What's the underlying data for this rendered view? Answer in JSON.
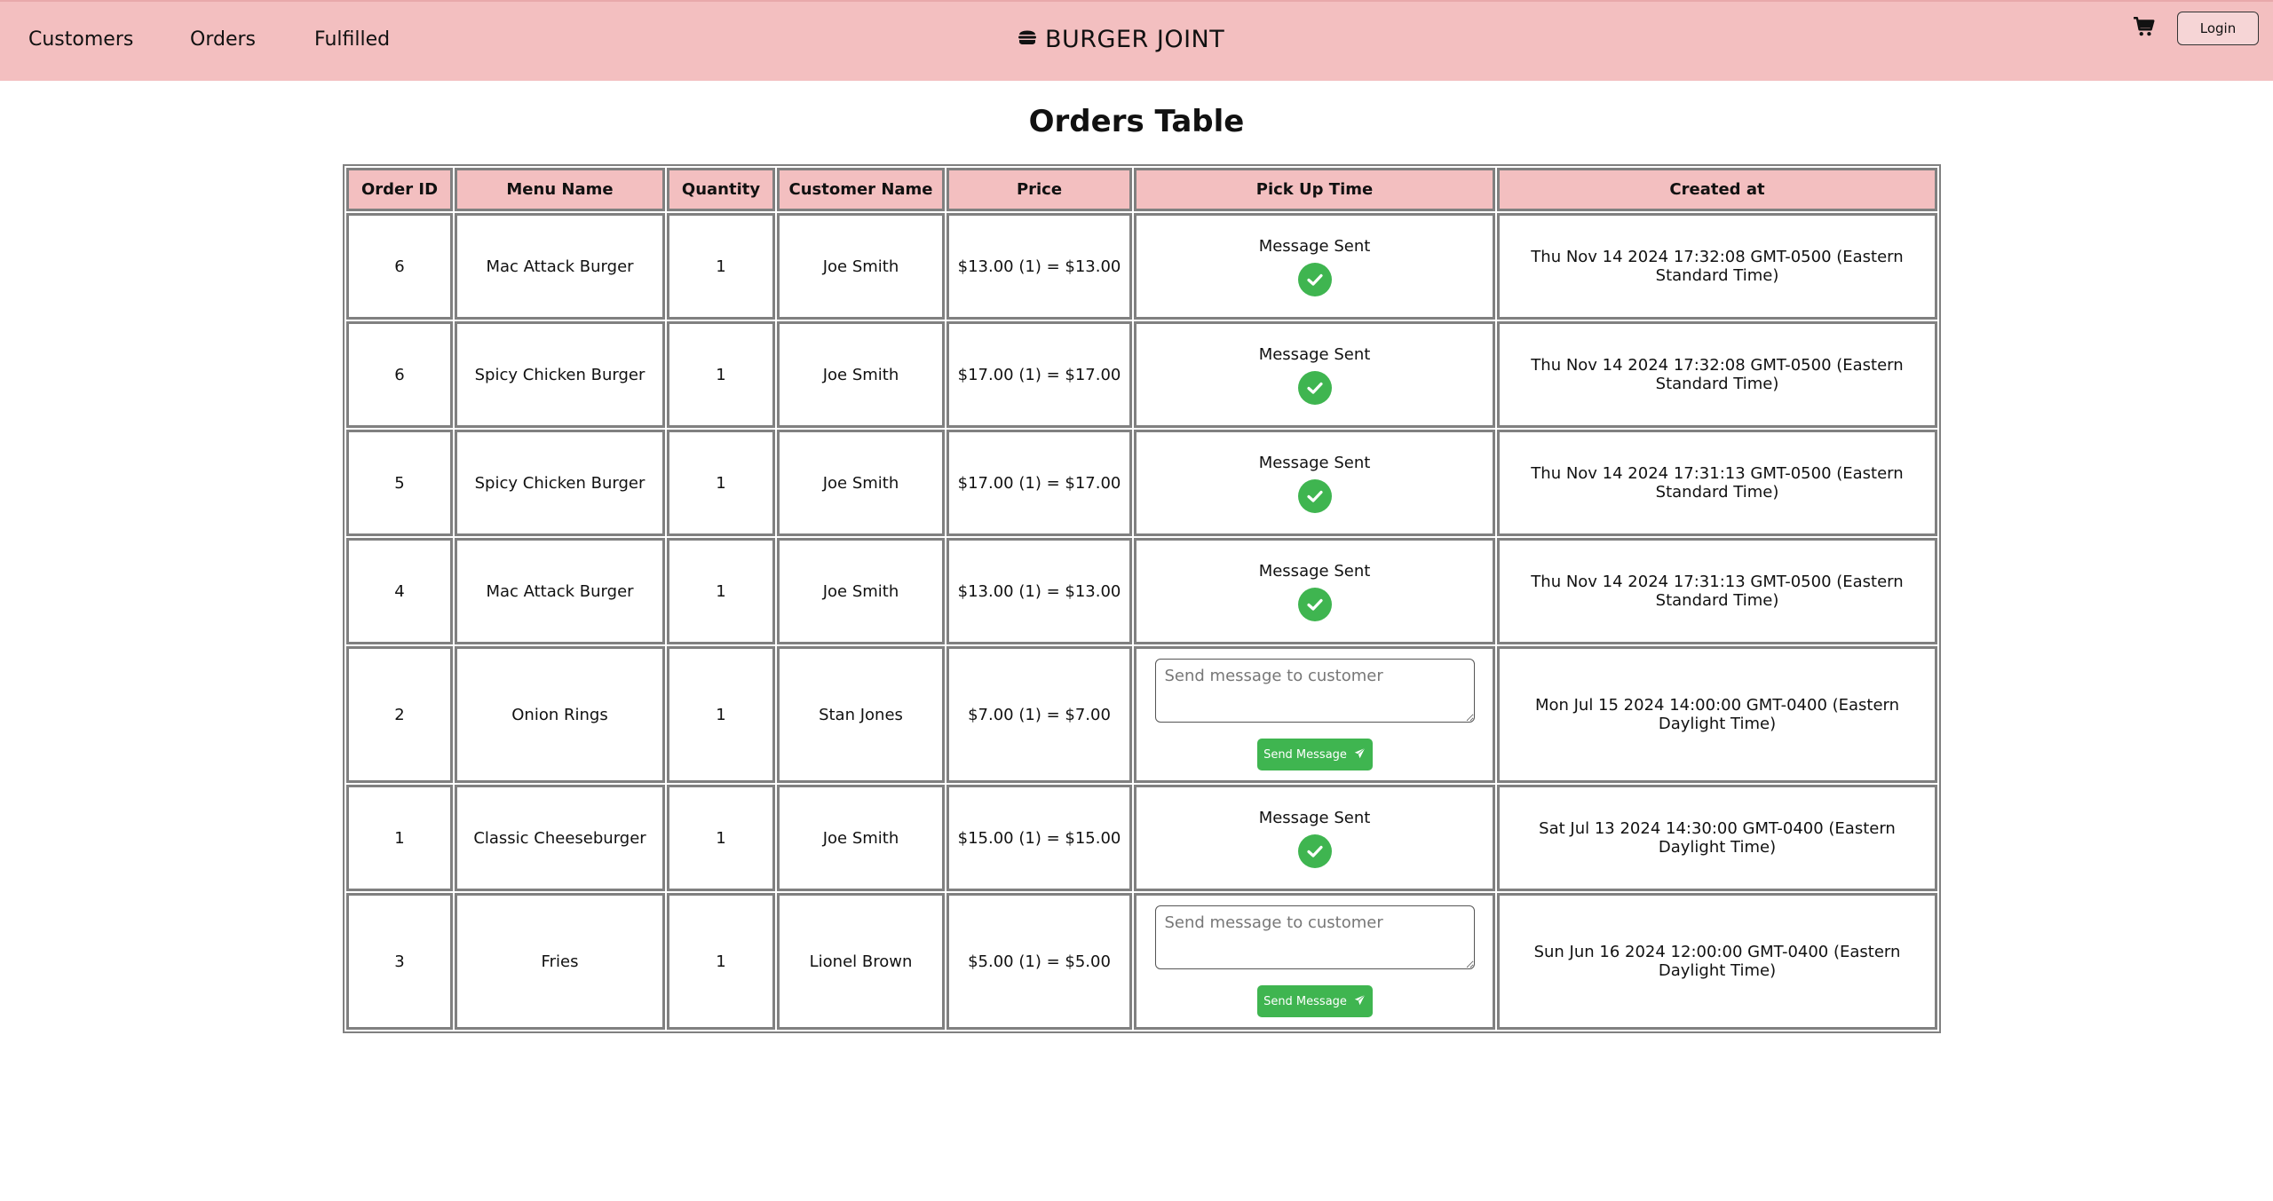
{
  "nav": {
    "links": [
      "Customers",
      "Orders",
      "Fulfilled"
    ],
    "brand": "BURGER JOINT",
    "brand_icon": "burger-icon",
    "cart_icon": "cart-icon",
    "login_label": "Login"
  },
  "colors": {
    "nav_bg": "#f3bfc0",
    "success_green": "#3fb550",
    "border_gray": "#808080"
  },
  "page_title": "Orders Table",
  "table": {
    "headers": [
      "Order ID",
      "Menu Name",
      "Quantity",
      "Customer Name",
      "Price",
      "Pick Up Time",
      "Created at"
    ],
    "rows": [
      {
        "id": "6",
        "menu": "Mac Attack Burger",
        "qty": "1",
        "customer": "Joe Smith",
        "price": "$13.00 (1) = $13.00",
        "status": "sent",
        "status_text": "Message Sent",
        "created": "Thu Nov 14 2024 17:32:08 GMT-0500 (Eastern Standard Time)"
      },
      {
        "id": "6",
        "menu": "Spicy Chicken Burger",
        "qty": "1",
        "customer": "Joe Smith",
        "price": "$17.00 (1) = $17.00",
        "status": "sent",
        "status_text": "Message Sent",
        "created": "Thu Nov 14 2024 17:32:08 GMT-0500 (Eastern Standard Time)"
      },
      {
        "id": "5",
        "menu": "Spicy Chicken Burger",
        "qty": "1",
        "customer": "Joe Smith",
        "price": "$17.00 (1) = $17.00",
        "status": "sent",
        "status_text": "Message Sent",
        "created": "Thu Nov 14 2024 17:31:13 GMT-0500 (Eastern Standard Time)"
      },
      {
        "id": "4",
        "menu": "Mac Attack Burger",
        "qty": "1",
        "customer": "Joe Smith",
        "price": "$13.00 (1) = $13.00",
        "status": "sent",
        "status_text": "Message Sent",
        "created": "Thu Nov 14 2024 17:31:13 GMT-0500 (Eastern Standard Time)"
      },
      {
        "id": "2",
        "menu": "Onion Rings",
        "qty": "1",
        "customer": "Stan Jones",
        "price": "$7.00 (1) = $7.00",
        "status": "pending",
        "input_placeholder": "Send message to customer",
        "button_label": "Send Message",
        "created": "Mon Jul 15 2024 14:00:00 GMT-0400 (Eastern Daylight Time)"
      },
      {
        "id": "1",
        "menu": "Classic Cheeseburger",
        "qty": "1",
        "customer": "Joe Smith",
        "price": "$15.00 (1) = $15.00",
        "status": "sent",
        "status_text": "Message Sent",
        "created": "Sat Jul 13 2024 14:30:00 GMT-0400 (Eastern Daylight Time)"
      },
      {
        "id": "3",
        "menu": "Fries",
        "qty": "1",
        "customer": "Lionel Brown",
        "price": "$5.00 (1) = $5.00",
        "status": "pending",
        "input_placeholder": "Send message to customer",
        "button_label": "Send Message",
        "created": "Sun Jun 16 2024 12:00:00 GMT-0400 (Eastern Daylight Time)"
      }
    ]
  }
}
